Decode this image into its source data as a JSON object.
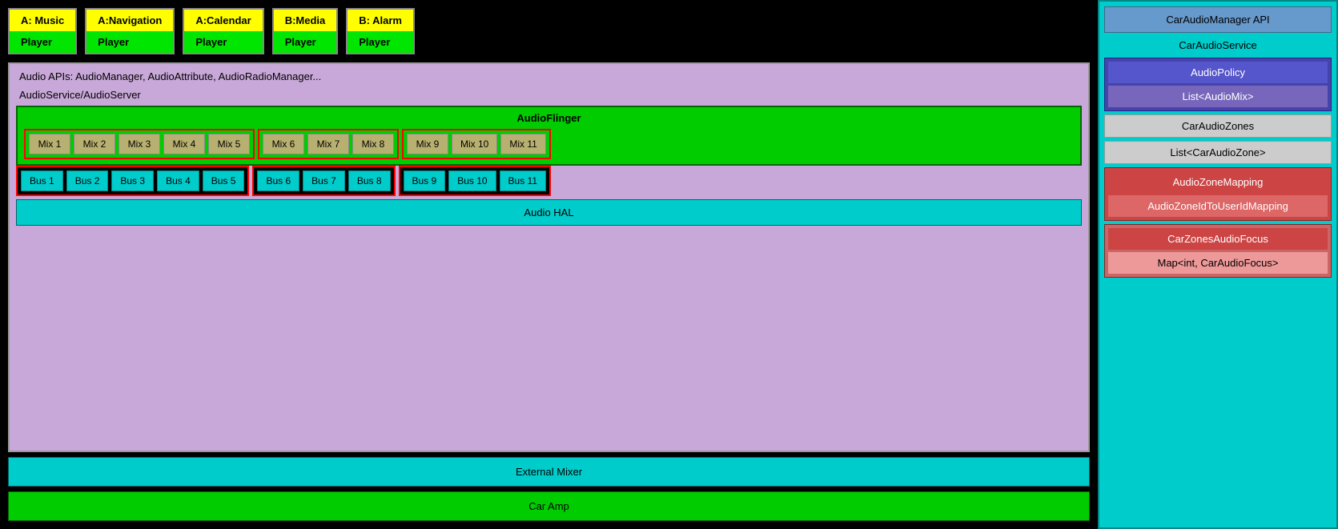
{
  "app_players": [
    {
      "app": "A: Music",
      "player": "Player"
    },
    {
      "app": "A:Navigation",
      "player": "Player"
    },
    {
      "app": "A:Calendar",
      "player": "Player"
    },
    {
      "app": "B:Media",
      "player": "Player"
    },
    {
      "app": "B: Alarm",
      "player": "Player"
    }
  ],
  "audio_apis_label": "Audio APIs: AudioManager, AudioAttribute, AudioRadioManager...",
  "audio_service_label": "AudioService/AudioServer",
  "audio_flinger_label": "AudioFlinger",
  "zones": [
    {
      "mixes": [
        "Mix 1",
        "Mix 2",
        "Mix 3",
        "Mix 4",
        "Mix 5"
      ],
      "buses": [
        "Bus 1",
        "Bus 2",
        "Bus 3",
        "Bus 4",
        "Bus 5"
      ]
    },
    {
      "mixes": [
        "Mix 6",
        "Mix 7",
        "Mix 8"
      ],
      "buses": [
        "Bus 6",
        "Bus 7",
        "Bus 8"
      ]
    },
    {
      "mixes": [
        "Mix 9",
        "Mix 10",
        "Mix 11"
      ],
      "buses": [
        "Bus 9",
        "Bus 10",
        "Bus 11"
      ]
    }
  ],
  "audio_hal_label": "Audio HAL",
  "external_mixer_label": "External Mixer",
  "car_amp_label": "Car Amp",
  "right": {
    "car_audio_manager_label": "CarAudioManager API",
    "car_audio_service_label": "CarAudioService",
    "audio_policy_label": "AudioPolicy",
    "list_audio_mix_label": "List<AudioMix>",
    "car_audio_zones_label": "CarAudioZones",
    "list_car_audio_zone_label": "List<CarAudioZone>",
    "audio_zone_mapping_label": "AudioZoneMapping",
    "audio_zone_id_mapping_label": "AudioZoneIdToUserIdMapping",
    "car_zones_audio_focus_label": "CarZonesAudioFocus",
    "map_car_audio_focus_label": "Map<int, CarAudioFocus>"
  }
}
